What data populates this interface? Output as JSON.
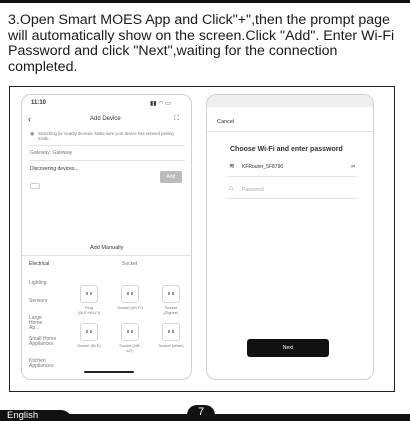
{
  "instruction": "3.Open Smart MOES App and Click\"+\",then the prompt page will automatically show on the screen.Click \"Add\". Enter Wi-Fi Password and click \"Next\",waiting for the connection completed.",
  "phone1": {
    "time": "11:10",
    "title": "Add Device",
    "notice": "Searching for nearby devices. Make sure your device has entered pairing mode.",
    "gateway": "Gateway: Gateway",
    "discovering": "Discovering devices...",
    "add_label": "Add",
    "add_manually": "Add Manually",
    "categories": [
      "Electrical",
      "Lighting",
      "Sensors",
      "Large Home Ap...",
      "Small Home Appliances",
      "Kitchen Appliances"
    ],
    "sub_header": "Socket",
    "row1": [
      "Plug (BLE+Wi-Fi)",
      "Socket (Wi-Fi)",
      "Socket (Zigbee)"
    ],
    "row2": [
      "Socket (BLE)",
      "Socket (NB-IoT)",
      "Socket (other)"
    ]
  },
  "phone2": {
    "cancel": "Cancel",
    "heading": "Choose Wi-Fi and enter password",
    "ssid": "KFRouter_5F8796",
    "password_placeholder": "Password",
    "next_label": "Next"
  },
  "footer": {
    "language": "English",
    "page": "7"
  }
}
